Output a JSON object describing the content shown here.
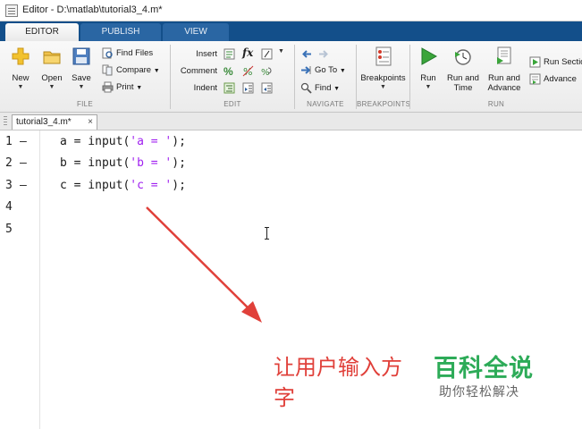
{
  "window": {
    "title": "Editor - D:\\matlab\\tutorial3_4.m*"
  },
  "ribbon_tabs": [
    {
      "label": "EDITOR",
      "active": true
    },
    {
      "label": "PUBLISH",
      "active": false
    },
    {
      "label": "VIEW",
      "active": false
    }
  ],
  "file_group": {
    "label": "FILE",
    "new_label": "New",
    "open_label": "Open",
    "save_label": "Save",
    "find_files_label": "Find Files",
    "compare_label": "Compare",
    "print_label": "Print"
  },
  "edit_group": {
    "label": "EDIT",
    "insert_label": "Insert",
    "comment_label": "Comment",
    "indent_label": "Indent",
    "fx_glyph": "fx"
  },
  "navigate_group": {
    "label": "NAVIGATE",
    "goto_label": "Go To",
    "find_label": "Find"
  },
  "breakpoints_group": {
    "label": "BREAKPOINTS",
    "breakpoints_label": "Breakpoints"
  },
  "run_group": {
    "label": "RUN",
    "run_label": "Run",
    "run_and_time_line1": "Run and",
    "run_and_time_line2": "Time",
    "run_and_advance_line1": "Run and",
    "run_and_advance_line2": "Advance",
    "run_section_label": "Run Sectio",
    "advance_label": "Advance"
  },
  "document": {
    "tab_label": "tutorial3_4.m*",
    "close_glyph": "×",
    "lines": [
      {
        "number": "1",
        "marker": "—",
        "pre": "a = input(",
        "str": "'a = '",
        "post": ");"
      },
      {
        "number": "2",
        "marker": "—",
        "pre": "b = input(",
        "str": "'b = '",
        "post": ");"
      },
      {
        "number": "3",
        "marker": "—",
        "pre": "c = input(",
        "str": "'c = '",
        "post": ");"
      },
      {
        "number": "4",
        "marker": "",
        "pre": "",
        "str": "",
        "post": ""
      },
      {
        "number": "5",
        "marker": "",
        "pre": "",
        "str": "",
        "post": ""
      }
    ]
  },
  "annotation": {
    "line1": "让用户输入方",
    "line2": "字",
    "color": "#e0403a"
  },
  "watermark": {
    "main": "百科全说",
    "sub": "助你轻松解决",
    "color": "#2dab58"
  },
  "colors": {
    "tabstrip": "#134f8a",
    "string": "#a020f0"
  }
}
